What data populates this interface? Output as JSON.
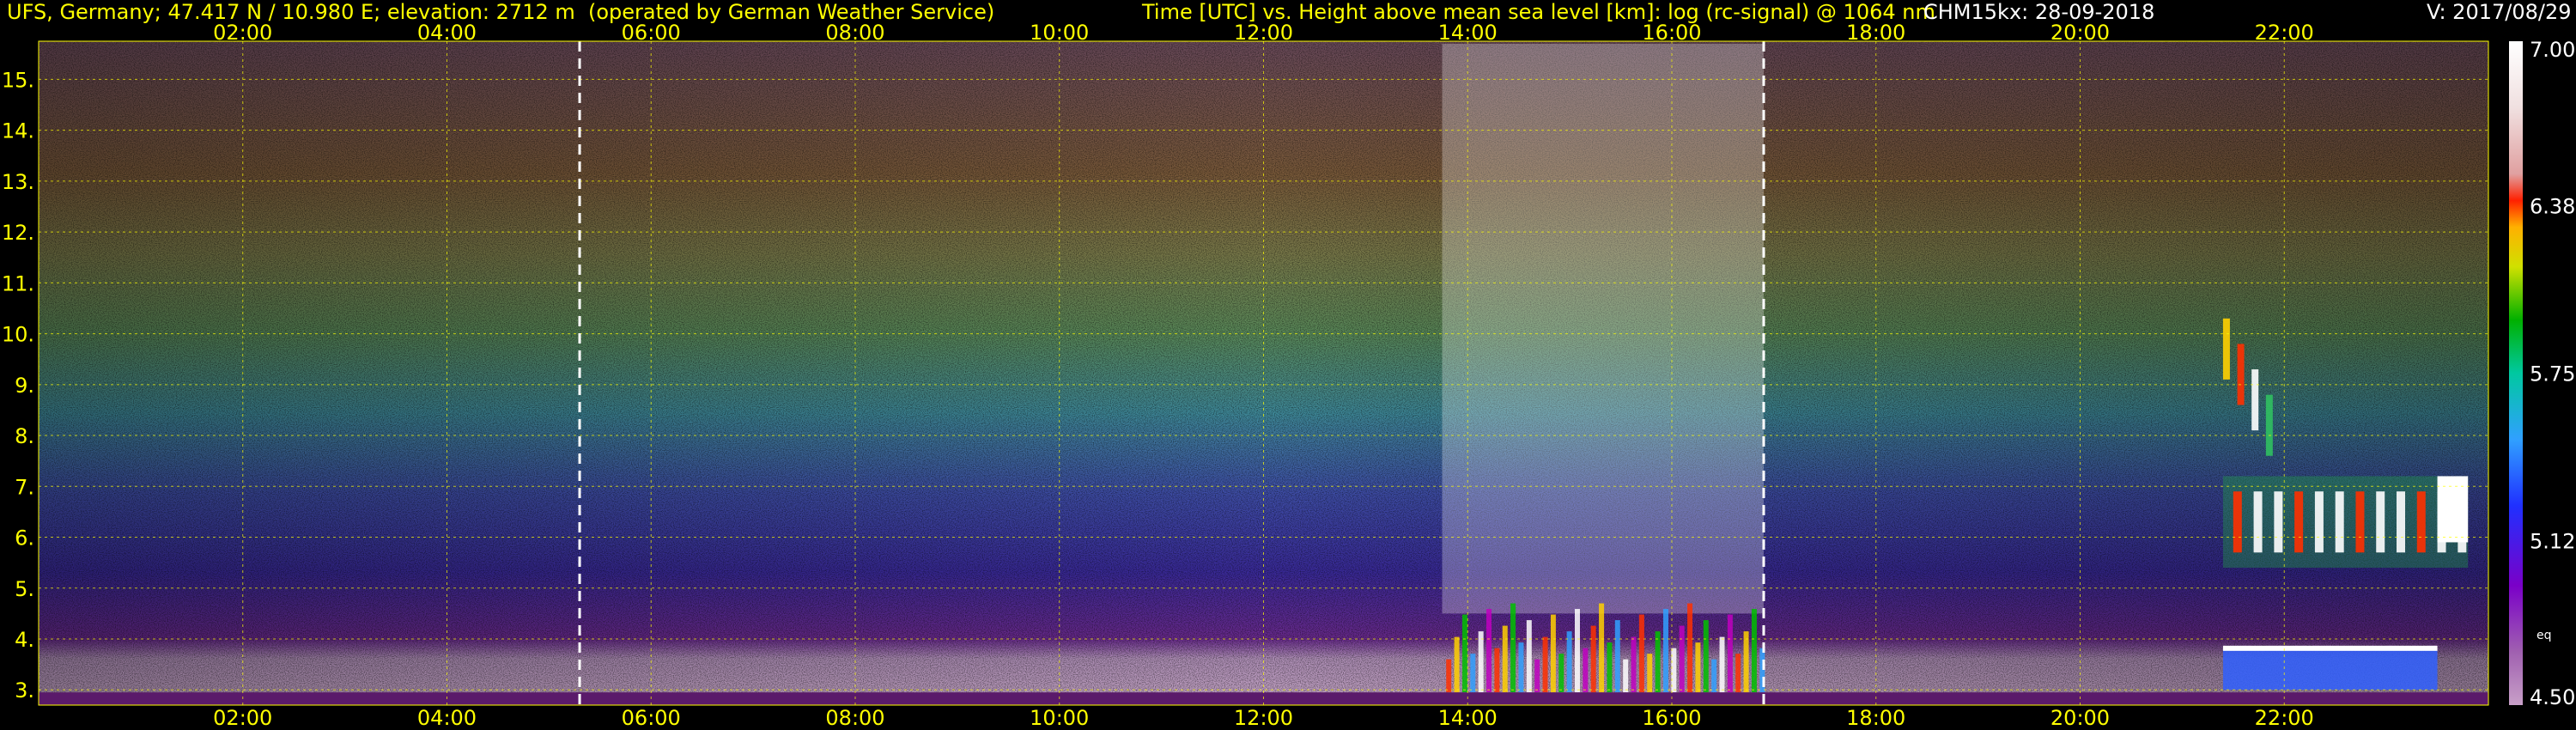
{
  "header": {
    "station": "UFS, Germany; 47.417 N / 10.980 E; elevation: 2712 m  (operated by German Weather Service)",
    "title": "Time [UTC] vs. Height above mean sea level [km]: log (rc-signal) @ 1064 nm",
    "instrument": "CHM15kx: 28-09-2018",
    "version": "V: 2017/08/29"
  },
  "colors": {
    "text_yellow": "#ffff00",
    "text_white": "#ffffff",
    "grid": "#ffff00",
    "background": "#000000",
    "marker": "#ffffff"
  },
  "chart_data": {
    "type": "heatmap",
    "title": "Time [UTC] vs. Height above mean sea level [km]: log (rc-signal) @ 1064 nm",
    "xlabel": "Time [UTC]",
    "ylabel": "Height above mean sea level [km]",
    "x_ticks": [
      "02:00",
      "04:00",
      "06:00",
      "08:00",
      "10:00",
      "12:00",
      "14:00",
      "16:00",
      "18:00",
      "20:00",
      "22:00"
    ],
    "x_tick_hours": [
      2,
      4,
      6,
      8,
      10,
      12,
      14,
      16,
      18,
      20,
      22
    ],
    "xlim_hours": [
      0,
      24
    ],
    "y_ticks": [
      "3.",
      "4.",
      "5.",
      "6.",
      "7.",
      "8.",
      "9.",
      "10.",
      "11.",
      "12.",
      "13.",
      "14.",
      "15."
    ],
    "y_tick_values": [
      3,
      4,
      5,
      6,
      7,
      8,
      9,
      10,
      11,
      12,
      13,
      14,
      15
    ],
    "ylim_km": [
      2.7,
      15.75
    ],
    "grid": true,
    "markers_hours": [
      5.3,
      16.9
    ],
    "colorbar": {
      "ticks": [
        "7.00",
        "6.38",
        "5.75",
        "5.12",
        "4.50"
      ],
      "tick_values": [
        7.0,
        6.38,
        5.75,
        5.12,
        4.5
      ],
      "range": [
        4.5,
        7.0
      ],
      "side_label": "eq"
    },
    "features": [
      {
        "name": "convective boundary layer plumes",
        "start_hour": 13.75,
        "end_hour": 16.9,
        "top_km": 4.7
      },
      {
        "name": "cloud layer",
        "start_hour": 21.4,
        "end_hour": 23.8,
        "bottom_km": 5.4,
        "top_km": 7.2
      },
      {
        "name": "high cloud",
        "start_hour": 21.4,
        "end_hour": 21.9,
        "bottom_km": 7.8,
        "top_km": 10.3
      },
      {
        "name": "low cloud base",
        "start_hour": 21.4,
        "end_hour": 23.5,
        "bottom_km": 3.0,
        "top_km": 3.8
      }
    ]
  }
}
